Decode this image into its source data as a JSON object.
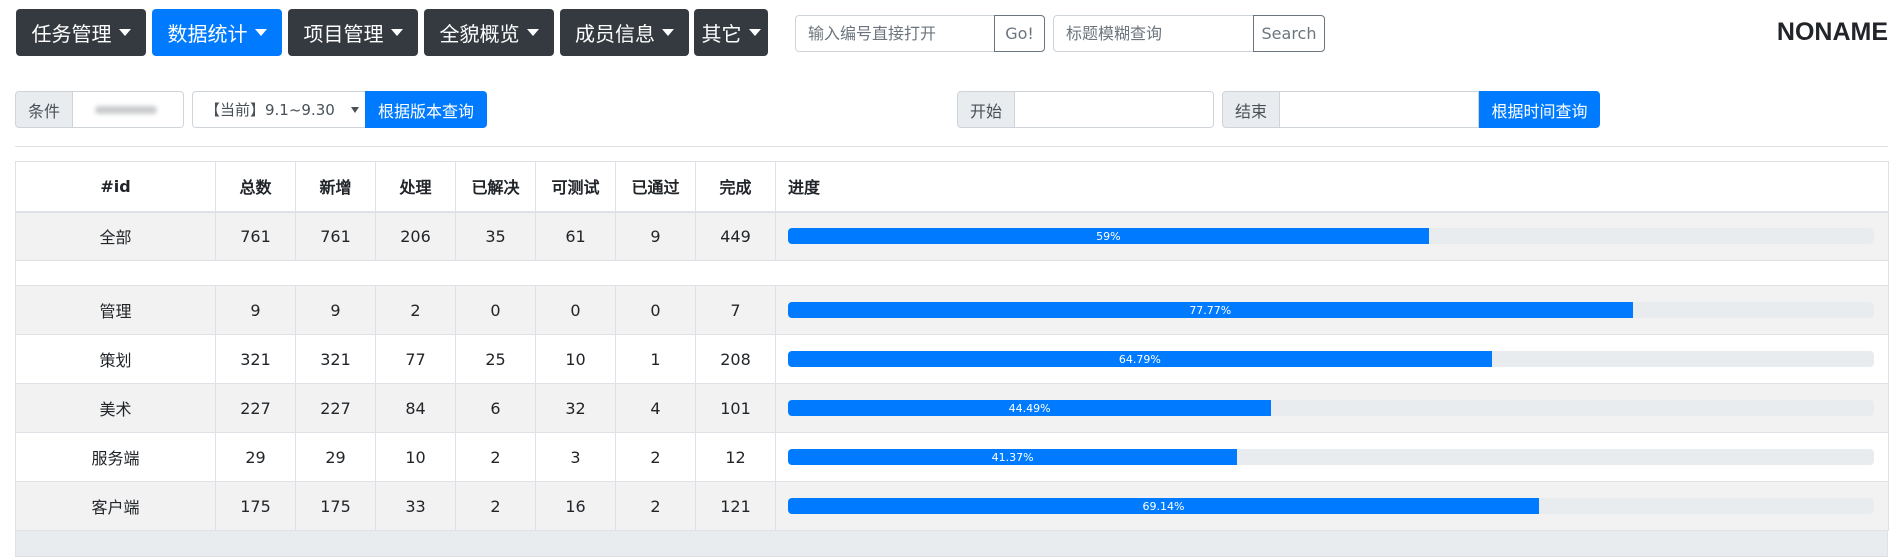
{
  "nav": {
    "menus": [
      {
        "label": "任务管理",
        "active": false
      },
      {
        "label": "数据统计",
        "active": true
      },
      {
        "label": "项目管理",
        "active": false
      },
      {
        "label": "全貌概览",
        "active": false
      },
      {
        "label": "成员信息",
        "active": false
      },
      {
        "label": "其它",
        "active": false
      }
    ],
    "id_search": {
      "placeholder": "输入编号直接打开",
      "button": "Go!"
    },
    "title_search": {
      "placeholder": "标题模糊查询",
      "button": "Search"
    },
    "brand": "NONAME"
  },
  "filters": {
    "condition_label": "条件",
    "version_select": "【当前】9.1~9.30",
    "version_button": "根据版本查询",
    "start_label": "开始",
    "end_label": "结束",
    "time_button": "根据时间查询"
  },
  "table": {
    "headers": [
      "#id",
      "总数",
      "新增",
      "处理",
      "已解决",
      "可测试",
      "已通过",
      "完成",
      "进度"
    ],
    "total_row": {
      "cells": [
        "全部",
        "761",
        "761",
        "206",
        "35",
        "61",
        "9",
        "449"
      ],
      "progress": 0.59,
      "progress_label": "59%"
    },
    "rows": [
      {
        "cells": [
          "管理",
          "9",
          "9",
          "2",
          "0",
          "0",
          "0",
          "7"
        ],
        "progress": 0.7777,
        "progress_label": "77.77%"
      },
      {
        "cells": [
          "策划",
          "321",
          "321",
          "77",
          "25",
          "10",
          "1",
          "208"
        ],
        "progress": 0.6479,
        "progress_label": "64.79%"
      },
      {
        "cells": [
          "美术",
          "227",
          "227",
          "84",
          "6",
          "32",
          "4",
          "101"
        ],
        "progress": 0.4449,
        "progress_label": "44.49%"
      },
      {
        "cells": [
          "服务端",
          "29",
          "29",
          "10",
          "2",
          "3",
          "2",
          "12"
        ],
        "progress": 0.4137,
        "progress_label": "41.37%"
      },
      {
        "cells": [
          "客户端",
          "175",
          "175",
          "33",
          "2",
          "16",
          "2",
          "121"
        ],
        "progress": 0.6914,
        "progress_label": "69.14%"
      }
    ]
  },
  "colors": {
    "primary": "#007bff",
    "dark": "#343a40",
    "track": "#e9ecef",
    "stripe": "#f2f2f2"
  }
}
